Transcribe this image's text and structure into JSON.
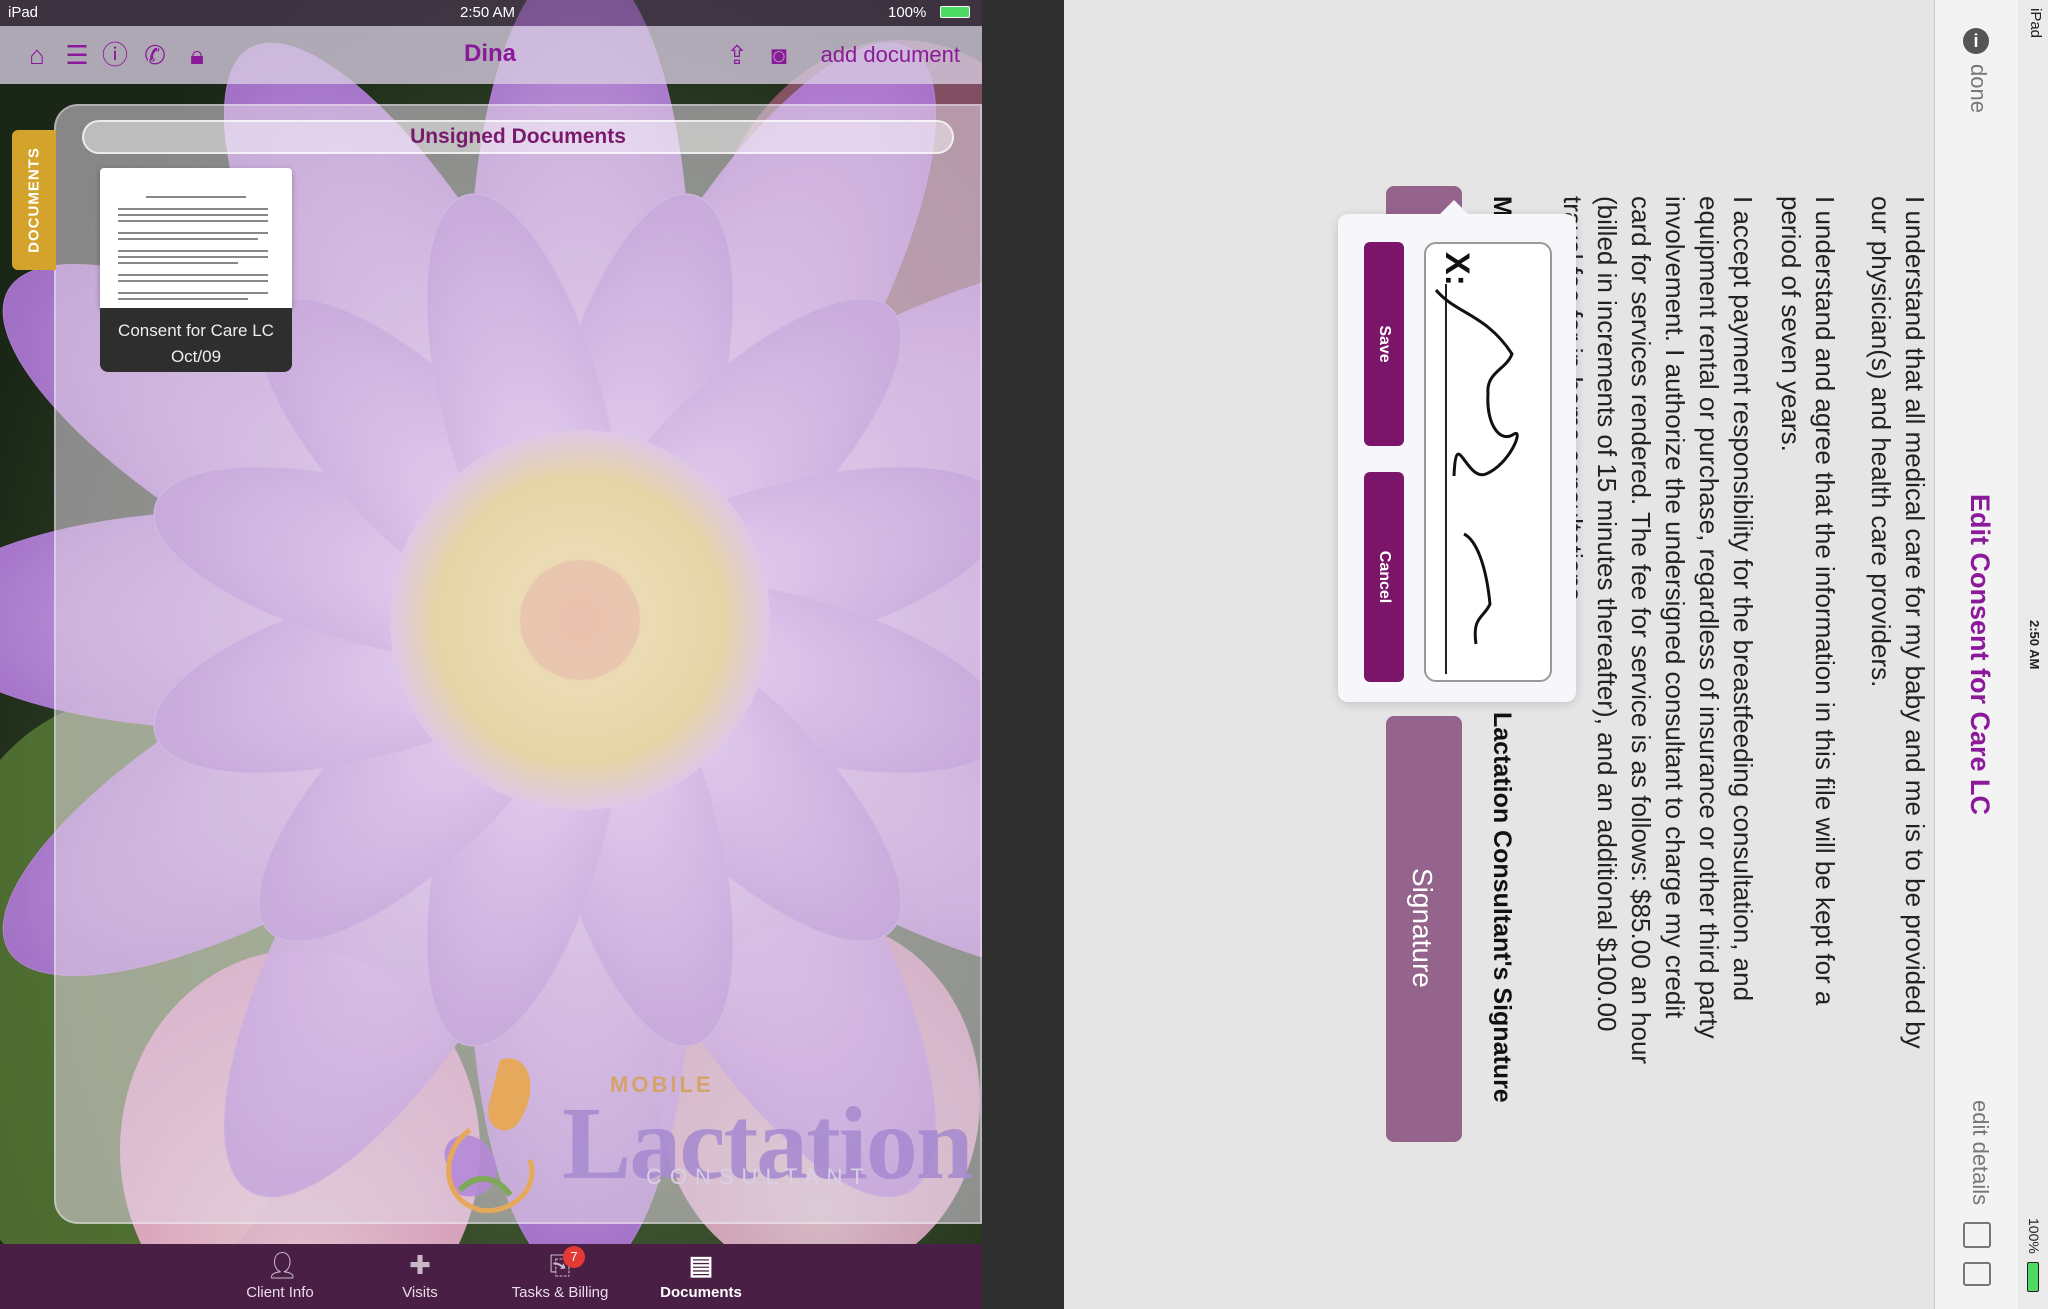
{
  "left": {
    "status": {
      "carrier": "iPad",
      "time": "2:50 AM",
      "battery": "100%"
    },
    "nav": {
      "title": "Dina",
      "add_document": "add document",
      "icons": [
        "home-icon",
        "list-icon",
        "info-icon",
        "phone-icon",
        "lock-icon",
        "share-icon",
        "camera-icon"
      ]
    },
    "panel_title": "Unsigned Documents",
    "docs_tab": "DOCUMENTS",
    "document": {
      "name": "Consent for Care LC",
      "date": "Oct/09"
    },
    "logo": {
      "mobile": "MOBILE",
      "main": "Lactation",
      "sub": "CONSULTANT"
    },
    "tabs": [
      {
        "label": "Client Info",
        "icon": "person-icon"
      },
      {
        "label": "Visits",
        "icon": "medical-bag-icon"
      },
      {
        "label": "Tasks & Billing",
        "icon": "tray-icon",
        "badge": "7"
      },
      {
        "label": "Documents",
        "icon": "cabinet-icon"
      }
    ],
    "colors": {
      "accent": "#8b1a9a",
      "tabbar": "#4a1f45",
      "badge": "#e53935"
    }
  },
  "right": {
    "status": {
      "carrier": "iPad",
      "time": "2:50 AM",
      "battery": "100%"
    },
    "nav": {
      "title": "Edit Consent for Care LC",
      "done": "done",
      "edit_details": "edit details"
    },
    "paragraphs": [
      "I understand that all medical care for my baby and me is to be provided by our physician(s) and health care providers.",
      "I understand and agree that the information in this file will be kept for a period of seven years.",
      "I accept payment responsibility for the breastfeeding consultation, and equipment rental or purchase, regardless of insurance or other third party involvement. I authorize the undersigned consultant to charge my credit card for services rendered. The fee for service is as follows: $85.00 an hour (billed in increments of 15 minutes thereafter), and an additional $100.00 travel fee for in-home consultations."
    ],
    "partial_label": "M",
    "signature_label": "Lactation Consultant's Signature",
    "signature_button": "Signature",
    "popover": {
      "save": "Save",
      "cancel": "Cancel",
      "x_mark": "X:"
    },
    "colors": {
      "accent": "#8b1a9a",
      "button": "#94648c",
      "popover_button": "#7b1569"
    }
  }
}
